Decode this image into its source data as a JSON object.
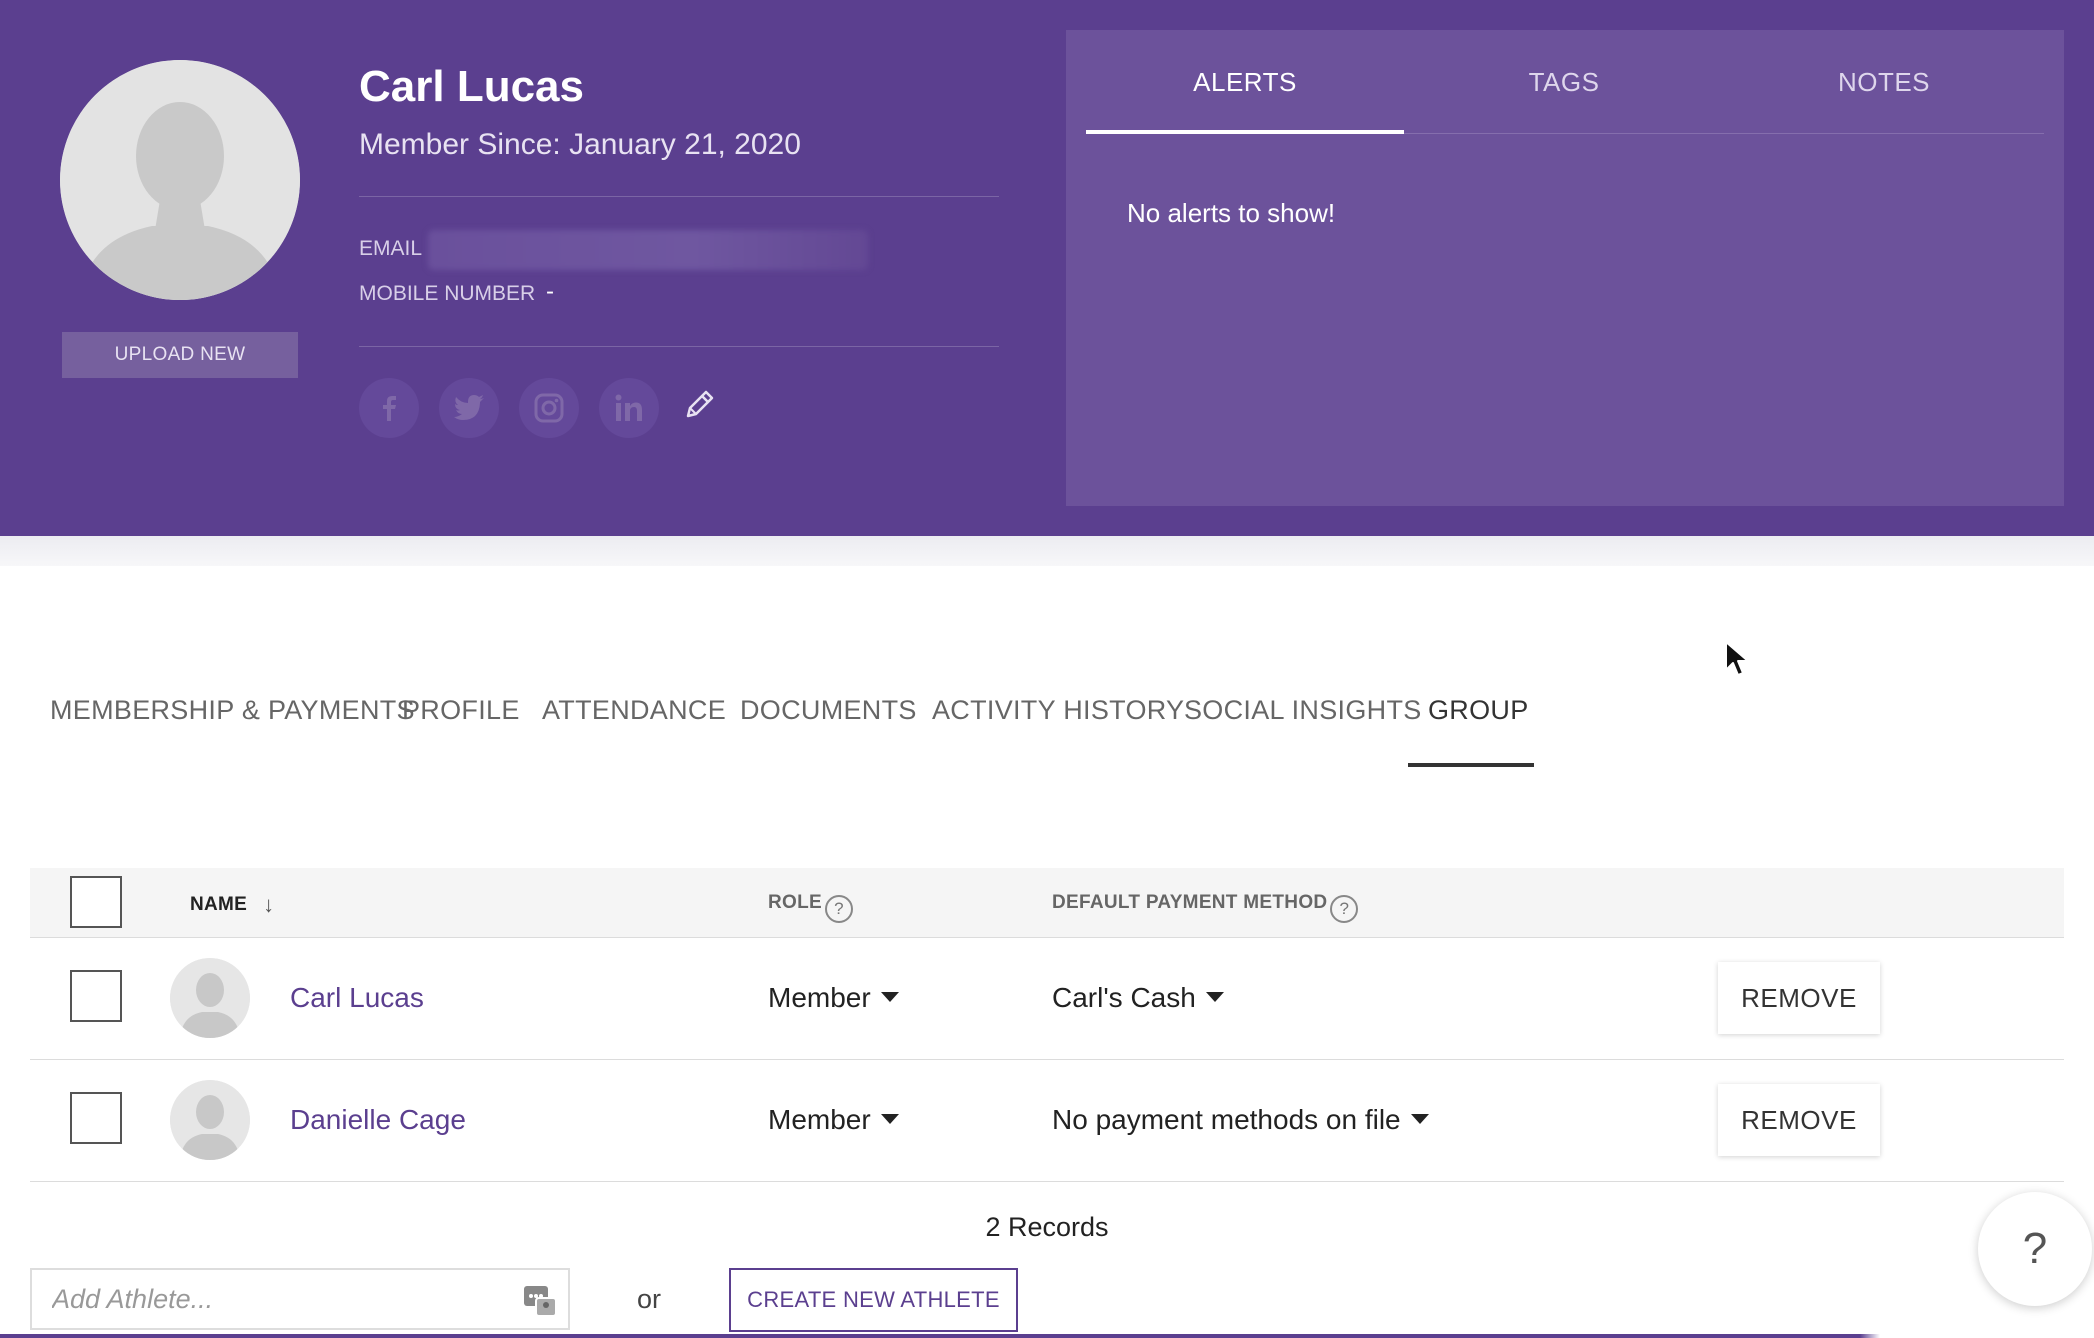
{
  "profile": {
    "name": "Carl Lucas",
    "member_since": "Member Since: January 21, 2020",
    "email_label": "EMAIL",
    "mobile_label": "MOBILE NUMBER",
    "mobile_value": "-",
    "upload_label": "UPLOAD NEW",
    "social_icons": [
      "facebook-icon",
      "twitter-icon",
      "instagram-icon",
      "linkedin-icon",
      "pencil-icon"
    ]
  },
  "panel": {
    "tabs": [
      {
        "label": "ALERTS",
        "active": true
      },
      {
        "label": "TAGS",
        "active": false
      },
      {
        "label": "NOTES",
        "active": false
      }
    ],
    "message": "No alerts to show!"
  },
  "tabs": [
    {
      "label": "MEMBERSHIP & PAYMENTS",
      "active": false
    },
    {
      "label": "PROFILE",
      "active": false
    },
    {
      "label": "ATTENDANCE",
      "active": false
    },
    {
      "label": "DOCUMENTS",
      "active": false
    },
    {
      "label": "ACTIVITY HISTORY",
      "active": false
    },
    {
      "label": "SOCIAL INSIGHTS",
      "active": false
    },
    {
      "label": "GROUP",
      "active": true
    }
  ],
  "table": {
    "columns": {
      "name": "NAME",
      "role": "ROLE",
      "payment": "DEFAULT PAYMENT METHOD"
    },
    "rows": [
      {
        "name": "Carl Lucas",
        "role": "Member",
        "payment": "Carl's Cash",
        "action": "REMOVE"
      },
      {
        "name": "Danielle Cage",
        "role": "Member",
        "payment": "No payment methods on file",
        "action": "REMOVE"
      }
    ],
    "records": "2 Records"
  },
  "bottom": {
    "add_placeholder": "Add Athlete...",
    "or": "or",
    "create_label": "CREATE NEW ATHLETE"
  },
  "help_fab": "?",
  "colors": {
    "brand": "#5b3f8f",
    "panel": "#6c529b"
  }
}
